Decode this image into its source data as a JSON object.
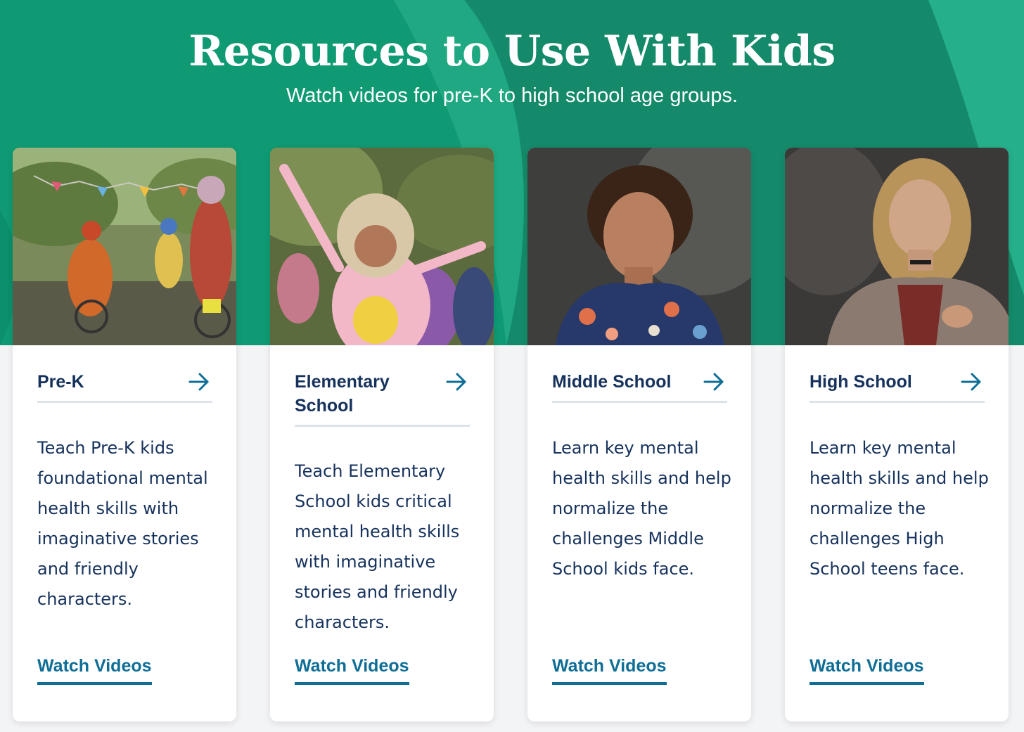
{
  "hero": {
    "title": "Resources to Use With Kids",
    "subtitle": "Watch videos for pre-K to high school age groups.",
    "background_color": "#0f9a74"
  },
  "colors": {
    "heading_navy": "#16325c",
    "link_blue": "#0f6e96",
    "divider": "#dde3ea"
  },
  "cards": [
    {
      "title": "Pre-K",
      "description": "Teach Pre-K kids foundational mental health skills with imaginative stories and friendly characters.",
      "link": "Watch Videos",
      "arrow_icon": "arrow-right-icon",
      "photo": "kids-riding-tricycles-photo"
    },
    {
      "title": "Elementary School",
      "description": "Teach Elementary School kids critical mental health skills with imaginative stories and friendly characters.",
      "link": "Watch Videos",
      "arrow_icon": "arrow-right-icon",
      "photo": "girl-cheering-in-costume-photo"
    },
    {
      "title": "Middle School",
      "description": "Learn key mental health skills and help normalize the challenges Middle School kids face.",
      "link": "Watch Videos",
      "arrow_icon": "arrow-right-icon",
      "photo": "smiling-boy-portrait-photo"
    },
    {
      "title": "High School",
      "description": "Learn key mental health skills and help normalize the challenges High School teens face.",
      "link": "Watch Videos",
      "arrow_icon": "arrow-right-icon",
      "photo": "teen-girl-portrait-photo"
    }
  ]
}
